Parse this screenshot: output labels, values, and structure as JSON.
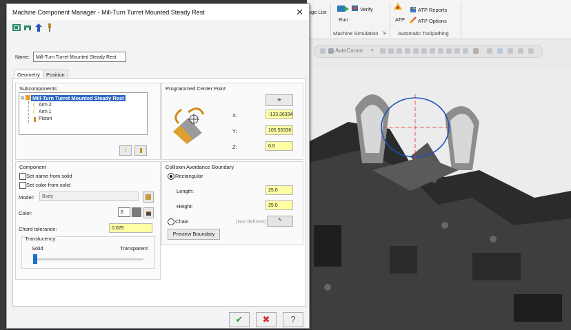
{
  "background_app": {
    "ribbon": {
      "page_list": "age List",
      "run": "Run",
      "verify": "Verify",
      "atp": "ATP",
      "atp_reports": "ATP Reports",
      "atp_options": "ATP Options",
      "group_machine_sim": "Machine Simulation",
      "group_auto_toolpath": "Automatic Toolpathing"
    },
    "viewport": {
      "autocursor": "AutoCursor"
    }
  },
  "dialog": {
    "title": "Machine Component Manager - Mill-Turn Turret Mounted Steady Rest",
    "close_glyph": "✕",
    "name_label": "Name:",
    "name_value": "Mill-Turn Turret Mounted Steady Rest",
    "tabs": [
      {
        "label": "Geometry"
      },
      {
        "label": "Position"
      }
    ],
    "subcomponents": {
      "title": "Subcomponents",
      "root": "Mill-Turn Turret Mounted Steady Rest",
      "children": [
        {
          "label": "Arm 2"
        },
        {
          "label": "Arm 1"
        },
        {
          "label": "Piston"
        }
      ]
    },
    "programmed_center": {
      "title": "Programmed Center Point",
      "x_label": "X:",
      "x_value": "-133.36334",
      "y_label": "Y:",
      "y_value": "105.55336",
      "z_label": "Z:",
      "z_value": "0.0"
    },
    "component": {
      "title": "Component",
      "set_name": "Set name from solid",
      "set_color": "Set color from solid",
      "model_label": "Model:",
      "model_value": "Body",
      "color_label": "Color:",
      "color_value": "8",
      "chord_label": "Chord tolerance:",
      "chord_value": "0.025",
      "translucency_title": "Translucency",
      "solid": "Solid",
      "transparent": "Transparent",
      "translucency_level": 0
    },
    "collision": {
      "title": "Collision Avoidance Boundary",
      "rectangular": "Rectangular",
      "length_label": "Length:",
      "length_value": "25.0",
      "height_label": "Height:",
      "height_value": "25.0",
      "chain": "Chain",
      "not_defined": "(Not defined)",
      "preview": "Preview Boundary"
    },
    "footer": {
      "ok": "✔",
      "cancel": "✖",
      "help": "?"
    }
  },
  "colors": {
    "field_yellow": "#ffffa4",
    "selection_blue": "#2f66c3",
    "ok_green": "#2e9b2e",
    "cancel_red": "#d12b2b"
  }
}
